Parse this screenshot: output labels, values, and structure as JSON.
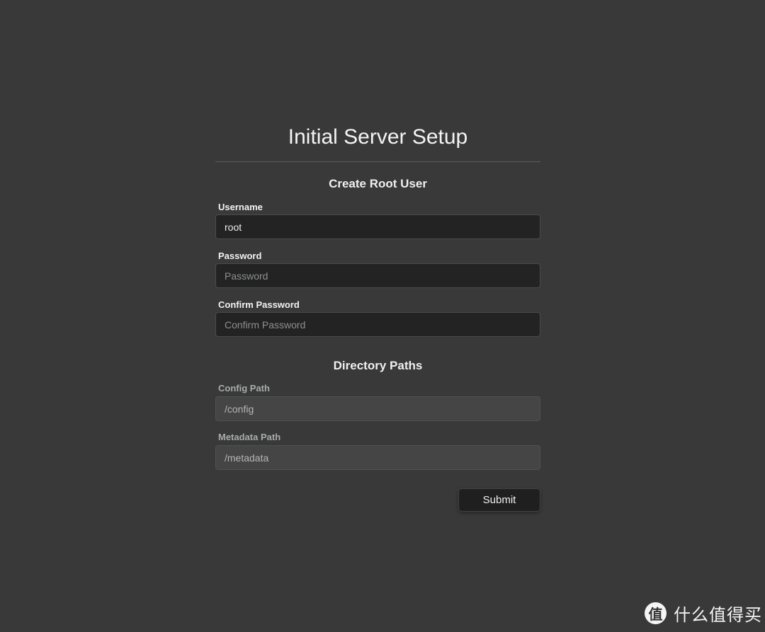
{
  "title": "Initial Server Setup",
  "sections": {
    "root_user": {
      "heading": "Create Root User",
      "username": {
        "label": "Username",
        "value": "root"
      },
      "password": {
        "label": "Password",
        "placeholder": "Password"
      },
      "confirm_password": {
        "label": "Confirm Password",
        "placeholder": "Confirm Password"
      }
    },
    "paths": {
      "heading": "Directory Paths",
      "config": {
        "label": "Config Path",
        "value": "/config"
      },
      "metadata": {
        "label": "Metadata Path",
        "value": "/metadata"
      }
    }
  },
  "submit_label": "Submit",
  "watermark": {
    "glyph": "值",
    "text": "什么值得买"
  }
}
